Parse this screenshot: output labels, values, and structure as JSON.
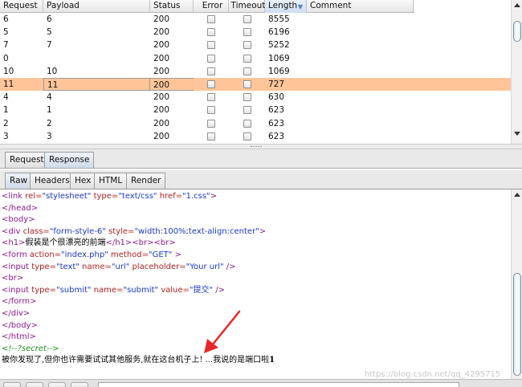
{
  "results": {
    "columns": [
      "Request",
      "Payload",
      "Status",
      "Error",
      "Timeout",
      "Length",
      "Comment"
    ],
    "sorted_column": "Length",
    "rows": [
      {
        "request": "6",
        "payload": "6",
        "status": "200",
        "length": "8555",
        "selected": false
      },
      {
        "request": "5",
        "payload": "5",
        "status": "200",
        "length": "6196",
        "selected": false
      },
      {
        "request": "7",
        "payload": "7",
        "status": "200",
        "length": "5252",
        "selected": false
      },
      {
        "request": "0",
        "payload": "",
        "status": "200",
        "length": "1069",
        "selected": false
      },
      {
        "request": "10",
        "payload": "10",
        "status": "200",
        "length": "1069",
        "selected": false
      },
      {
        "request": "11",
        "payload": "11",
        "status": "200",
        "length": "727",
        "selected": true
      },
      {
        "request": "4",
        "payload": "4",
        "status": "200",
        "length": "630",
        "selected": false
      },
      {
        "request": "1",
        "payload": "1",
        "status": "200",
        "length": "623",
        "selected": false
      },
      {
        "request": "2",
        "payload": "2",
        "status": "200",
        "length": "623",
        "selected": false
      },
      {
        "request": "3",
        "payload": "3",
        "status": "200",
        "length": "623",
        "selected": false
      }
    ]
  },
  "message_tabs": {
    "request": "Request",
    "response": "Response",
    "active": "Response"
  },
  "view_tabs": {
    "raw": "Raw",
    "headers": "Headers",
    "hex": "Hex",
    "html": "HTML",
    "render": "Render",
    "active": "Raw"
  },
  "response": {
    "l1": {
      "a": "<link ",
      "b": "rel=",
      "c": "\"stylesheet\" ",
      "d": "type=",
      "e": "\"text/css\" ",
      "f": "href=",
      "g": "\"1.css\"",
      "h": ">"
    },
    "l2": "</head>",
    "l3": "<body>",
    "l4": {
      "a": "<div ",
      "b": "class=",
      "c": "\"form-style-6\" ",
      "d": "style=",
      "e": "\"width:100%;text-align:center\"",
      "f": ">"
    },
    "l5": {
      "a": "<h1>",
      "b": "假装是个很漂亮的前端",
      "c": "</h1><br><br>"
    },
    "l6": {
      "a": "<form ",
      "b": "action=",
      "c": "\"index.php\" ",
      "d": "method=",
      "e": "\"GET\" ",
      "f": ">"
    },
    "l7": {
      "a": "<input ",
      "b": "type=",
      "c": "\"text\" ",
      "d": "name=",
      "e": "\"url\" ",
      "f": "placeholder=",
      "g": "\"Your url\" ",
      "h": "/>"
    },
    "l8": "<br>",
    "l9": {
      "a": "<input ",
      "b": "type=",
      "c": "\"submit\" ",
      "d": "name=",
      "e": "\"submit\" ",
      "f": "value=",
      "g": "\"提交\" ",
      "h": "/>"
    },
    "l10": "</form>",
    "l11": "</div>",
    "l12": "</body>",
    "l13": "</html>",
    "l14": "<!--?secret-->",
    "l15": {
      "a": "被你发现了,但你也许需要试试其他服务,就在这台机子上! ...我说的是端口啦",
      "b": "1"
    }
  },
  "watermark": "https://blog.csdn.net/qq_4295715",
  "colors": {
    "selected_row": "#ffc599",
    "annotation_arrow": "#e8262a"
  }
}
